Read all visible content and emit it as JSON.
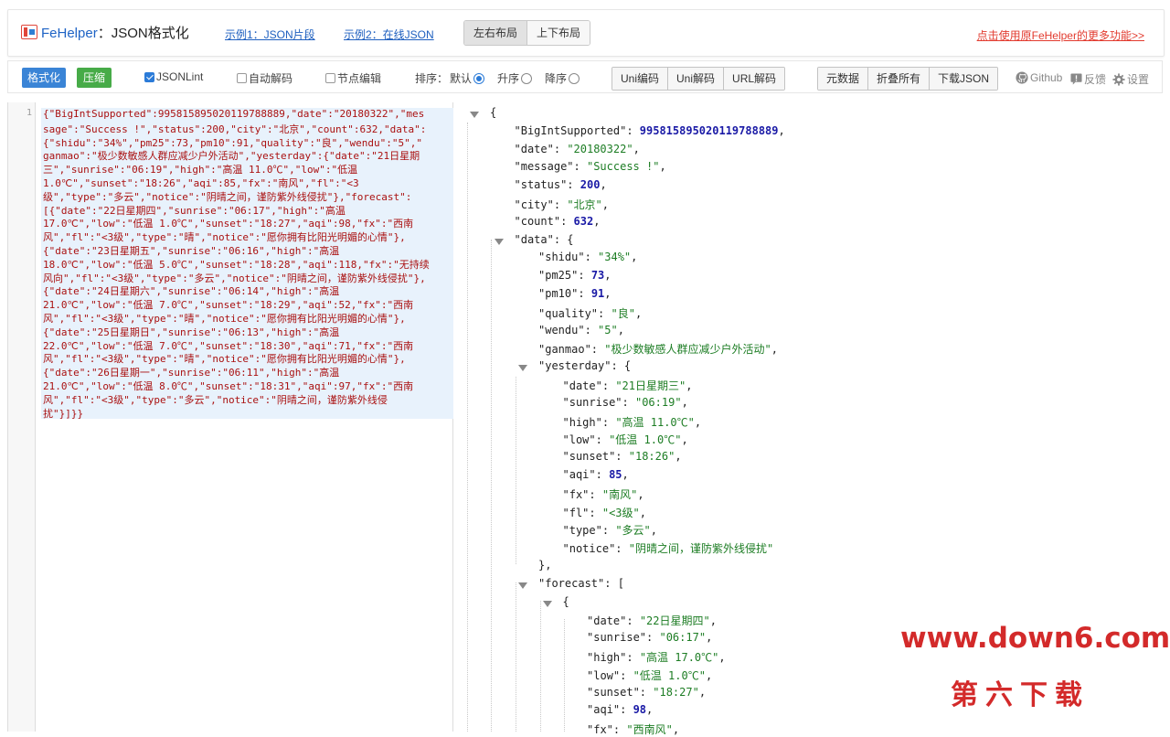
{
  "header": {
    "brand": "FeHelper",
    "brand_sep": "：",
    "brand_title": "JSON格式化",
    "example1": "示例1：JSON片段",
    "example2": "示例2：在线JSON",
    "layout_lr": "左右布局",
    "layout_tb": "上下布局",
    "more_link": "点击使用原FeHelper的更多功能>>"
  },
  "toolbar": {
    "format": "格式化",
    "compress": "压缩",
    "jsonlint": "JSONLint",
    "auto_decode": "自动解码",
    "node_edit": "节点编辑",
    "sort_label": "排序：",
    "sort_default": "默认",
    "sort_asc": "升序",
    "sort_desc": "降序",
    "uni_encode": "Uni编码",
    "uni_decode": "Uni解码",
    "url_decode": "URL解码",
    "meta": "元数据",
    "fold_all": "折叠所有",
    "download": "下载JSON",
    "github": "Github",
    "feedback": "反馈",
    "settings": "设置",
    "jsonlint_checked": true,
    "auto_decode_checked": false,
    "node_edit_checked": false,
    "sort_selected": "默认"
  },
  "editor": {
    "line_number": "1",
    "lines": [
      "{\"BigIntSupported\":995815895020119788889,\"date\":\"20180322\",\"mes",
      "sage\":\"Success !\",\"status\":200,\"city\":\"北京\",\"count\":632,\"data\":",
      "{\"shidu\":\"34%\",\"pm25\":73,\"pm10\":91,\"quality\":\"良\",\"wendu\":\"5\",\"",
      "ganmao\":\"极少数敏感人群应减少户外活动\",\"yesterday\":{\"date\":\"21日星期",
      "三\",\"sunrise\":\"06:19\",\"high\":\"高温 11.0℃\",\"low\":\"低温",
      "1.0℃\",\"sunset\":\"18:26\",\"aqi\":85,\"fx\":\"南风\",\"fl\":\"<3",
      "级\",\"type\":\"多云\",\"notice\":\"阴晴之间，谨防紫外线侵扰\"},\"forecast\":",
      "[{\"date\":\"22日星期四\",\"sunrise\":\"06:17\",\"high\":\"高温",
      "17.0℃\",\"low\":\"低温 1.0℃\",\"sunset\":\"18:27\",\"aqi\":98,\"fx\":\"西南",
      "风\",\"fl\":\"<3级\",\"type\":\"晴\",\"notice\":\"愿你拥有比阳光明媚的心情\"},",
      "{\"date\":\"23日星期五\",\"sunrise\":\"06:16\",\"high\":\"高温",
      "18.0℃\",\"low\":\"低温 5.0℃\",\"sunset\":\"18:28\",\"aqi\":118,\"fx\":\"无持续",
      "风向\",\"fl\":\"<3级\",\"type\":\"多云\",\"notice\":\"阴晴之间，谨防紫外线侵扰\"},",
      "{\"date\":\"24日星期六\",\"sunrise\":\"06:14\",\"high\":\"高温",
      "21.0℃\",\"low\":\"低温 7.0℃\",\"sunset\":\"18:29\",\"aqi\":52,\"fx\":\"西南",
      "风\",\"fl\":\"<3级\",\"type\":\"晴\",\"notice\":\"愿你拥有比阳光明媚的心情\"},",
      "{\"date\":\"25日星期日\",\"sunrise\":\"06:13\",\"high\":\"高温",
      "22.0℃\",\"low\":\"低温 7.0℃\",\"sunset\":\"18:30\",\"aqi\":71,\"fx\":\"西南",
      "风\",\"fl\":\"<3级\",\"type\":\"晴\",\"notice\":\"愿你拥有比阳光明媚的心情\"},",
      "{\"date\":\"26日星期一\",\"sunrise\":\"06:11\",\"high\":\"高温",
      "21.0℃\",\"low\":\"低温 8.0℃\",\"sunset\":\"18:31\",\"aqi\":97,\"fx\":\"西南",
      "风\",\"fl\":\"<3级\",\"type\":\"多云\",\"notice\":\"阴晴之间，谨防紫外线侵",
      "扰\"}]}}"
    ]
  },
  "viewer": {
    "lines": [
      {
        "indent": 0,
        "toggle": true,
        "parts": [
          [
            "p",
            "{"
          ]
        ]
      },
      {
        "indent": 1,
        "parts": [
          [
            "k",
            "\"BigIntSupported\""
          ],
          [
            "p",
            ": "
          ],
          [
            "n",
            "995815895020119788889"
          ],
          [
            "p",
            ","
          ]
        ]
      },
      {
        "indent": 1,
        "parts": [
          [
            "k",
            "\"date\""
          ],
          [
            "p",
            ": "
          ],
          [
            "s",
            "\"20180322\""
          ],
          [
            "p",
            ","
          ]
        ]
      },
      {
        "indent": 1,
        "parts": [
          [
            "k",
            "\"message\""
          ],
          [
            "p",
            ": "
          ],
          [
            "s",
            "\"Success !\""
          ],
          [
            "p",
            ","
          ]
        ]
      },
      {
        "indent": 1,
        "parts": [
          [
            "k",
            "\"status\""
          ],
          [
            "p",
            ": "
          ],
          [
            "n",
            "200"
          ],
          [
            "p",
            ","
          ]
        ]
      },
      {
        "indent": 1,
        "parts": [
          [
            "k",
            "\"city\""
          ],
          [
            "p",
            ": "
          ],
          [
            "s",
            "\"北京\""
          ],
          [
            "p",
            ","
          ]
        ]
      },
      {
        "indent": 1,
        "parts": [
          [
            "k",
            "\"count\""
          ],
          [
            "p",
            ": "
          ],
          [
            "n",
            "632"
          ],
          [
            "p",
            ","
          ]
        ]
      },
      {
        "indent": 1,
        "toggle": true,
        "parts": [
          [
            "k",
            "\"data\""
          ],
          [
            "p",
            ": {"
          ]
        ]
      },
      {
        "indent": 2,
        "parts": [
          [
            "k",
            "\"shidu\""
          ],
          [
            "p",
            ": "
          ],
          [
            "s",
            "\"34%\""
          ],
          [
            "p",
            ","
          ]
        ]
      },
      {
        "indent": 2,
        "parts": [
          [
            "k",
            "\"pm25\""
          ],
          [
            "p",
            ": "
          ],
          [
            "n",
            "73"
          ],
          [
            "p",
            ","
          ]
        ]
      },
      {
        "indent": 2,
        "parts": [
          [
            "k",
            "\"pm10\""
          ],
          [
            "p",
            ": "
          ],
          [
            "n",
            "91"
          ],
          [
            "p",
            ","
          ]
        ]
      },
      {
        "indent": 2,
        "parts": [
          [
            "k",
            "\"quality\""
          ],
          [
            "p",
            ": "
          ],
          [
            "s",
            "\"良\""
          ],
          [
            "p",
            ","
          ]
        ]
      },
      {
        "indent": 2,
        "parts": [
          [
            "k",
            "\"wendu\""
          ],
          [
            "p",
            ": "
          ],
          [
            "s",
            "\"5\""
          ],
          [
            "p",
            ","
          ]
        ]
      },
      {
        "indent": 2,
        "parts": [
          [
            "k",
            "\"ganmao\""
          ],
          [
            "p",
            ": "
          ],
          [
            "s",
            "\"极少数敏感人群应减少户外活动\""
          ],
          [
            "p",
            ","
          ]
        ]
      },
      {
        "indent": 2,
        "toggle": true,
        "parts": [
          [
            "k",
            "\"yesterday\""
          ],
          [
            "p",
            ": {"
          ]
        ]
      },
      {
        "indent": 3,
        "parts": [
          [
            "k",
            "\"date\""
          ],
          [
            "p",
            ": "
          ],
          [
            "s",
            "\"21日星期三\""
          ],
          [
            "p",
            ","
          ]
        ]
      },
      {
        "indent": 3,
        "parts": [
          [
            "k",
            "\"sunrise\""
          ],
          [
            "p",
            ": "
          ],
          [
            "s",
            "\"06:19\""
          ],
          [
            "p",
            ","
          ]
        ]
      },
      {
        "indent": 3,
        "parts": [
          [
            "k",
            "\"high\""
          ],
          [
            "p",
            ": "
          ],
          [
            "s",
            "\"高温 11.0℃\""
          ],
          [
            "p",
            ","
          ]
        ]
      },
      {
        "indent": 3,
        "parts": [
          [
            "k",
            "\"low\""
          ],
          [
            "p",
            ": "
          ],
          [
            "s",
            "\"低温 1.0℃\""
          ],
          [
            "p",
            ","
          ]
        ]
      },
      {
        "indent": 3,
        "parts": [
          [
            "k",
            "\"sunset\""
          ],
          [
            "p",
            ": "
          ],
          [
            "s",
            "\"18:26\""
          ],
          [
            "p",
            ","
          ]
        ]
      },
      {
        "indent": 3,
        "parts": [
          [
            "k",
            "\"aqi\""
          ],
          [
            "p",
            ": "
          ],
          [
            "n",
            "85"
          ],
          [
            "p",
            ","
          ]
        ]
      },
      {
        "indent": 3,
        "parts": [
          [
            "k",
            "\"fx\""
          ],
          [
            "p",
            ": "
          ],
          [
            "s",
            "\"南风\""
          ],
          [
            "p",
            ","
          ]
        ]
      },
      {
        "indent": 3,
        "parts": [
          [
            "k",
            "\"fl\""
          ],
          [
            "p",
            ": "
          ],
          [
            "s",
            "\"<3级\""
          ],
          [
            "p",
            ","
          ]
        ]
      },
      {
        "indent": 3,
        "parts": [
          [
            "k",
            "\"type\""
          ],
          [
            "p",
            ": "
          ],
          [
            "s",
            "\"多云\""
          ],
          [
            "p",
            ","
          ]
        ]
      },
      {
        "indent": 3,
        "parts": [
          [
            "k",
            "\"notice\""
          ],
          [
            "p",
            ": "
          ],
          [
            "s",
            "\"阴晴之间，谨防紫外线侵扰\""
          ]
        ]
      },
      {
        "indent": 2,
        "parts": [
          [
            "p",
            "},"
          ]
        ]
      },
      {
        "indent": 2,
        "toggle": true,
        "parts": [
          [
            "k",
            "\"forecast\""
          ],
          [
            "p",
            ": ["
          ]
        ]
      },
      {
        "indent": 3,
        "toggle": true,
        "parts": [
          [
            "p",
            "{"
          ]
        ]
      },
      {
        "indent": 4,
        "parts": [
          [
            "k",
            "\"date\""
          ],
          [
            "p",
            ": "
          ],
          [
            "s",
            "\"22日星期四\""
          ],
          [
            "p",
            ","
          ]
        ]
      },
      {
        "indent": 4,
        "parts": [
          [
            "k",
            "\"sunrise\""
          ],
          [
            "p",
            ": "
          ],
          [
            "s",
            "\"06:17\""
          ],
          [
            "p",
            ","
          ]
        ]
      },
      {
        "indent": 4,
        "parts": [
          [
            "k",
            "\"high\""
          ],
          [
            "p",
            ": "
          ],
          [
            "s",
            "\"高温 17.0℃\""
          ],
          [
            "p",
            ","
          ]
        ]
      },
      {
        "indent": 4,
        "parts": [
          [
            "k",
            "\"low\""
          ],
          [
            "p",
            ": "
          ],
          [
            "s",
            "\"低温 1.0℃\""
          ],
          [
            "p",
            ","
          ]
        ]
      },
      {
        "indent": 4,
        "parts": [
          [
            "k",
            "\"sunset\""
          ],
          [
            "p",
            ": "
          ],
          [
            "s",
            "\"18:27\""
          ],
          [
            "p",
            ","
          ]
        ]
      },
      {
        "indent": 4,
        "parts": [
          [
            "k",
            "\"aqi\""
          ],
          [
            "p",
            ": "
          ],
          [
            "n",
            "98"
          ],
          [
            "p",
            ","
          ]
        ]
      },
      {
        "indent": 4,
        "parts": [
          [
            "k",
            "\"fx\""
          ],
          [
            "p",
            ": "
          ],
          [
            "s",
            "\"西南风\""
          ],
          [
            "p",
            ","
          ]
        ]
      }
    ]
  },
  "watermark": {
    "url": "www.down6.com",
    "cn": "第六下载"
  }
}
